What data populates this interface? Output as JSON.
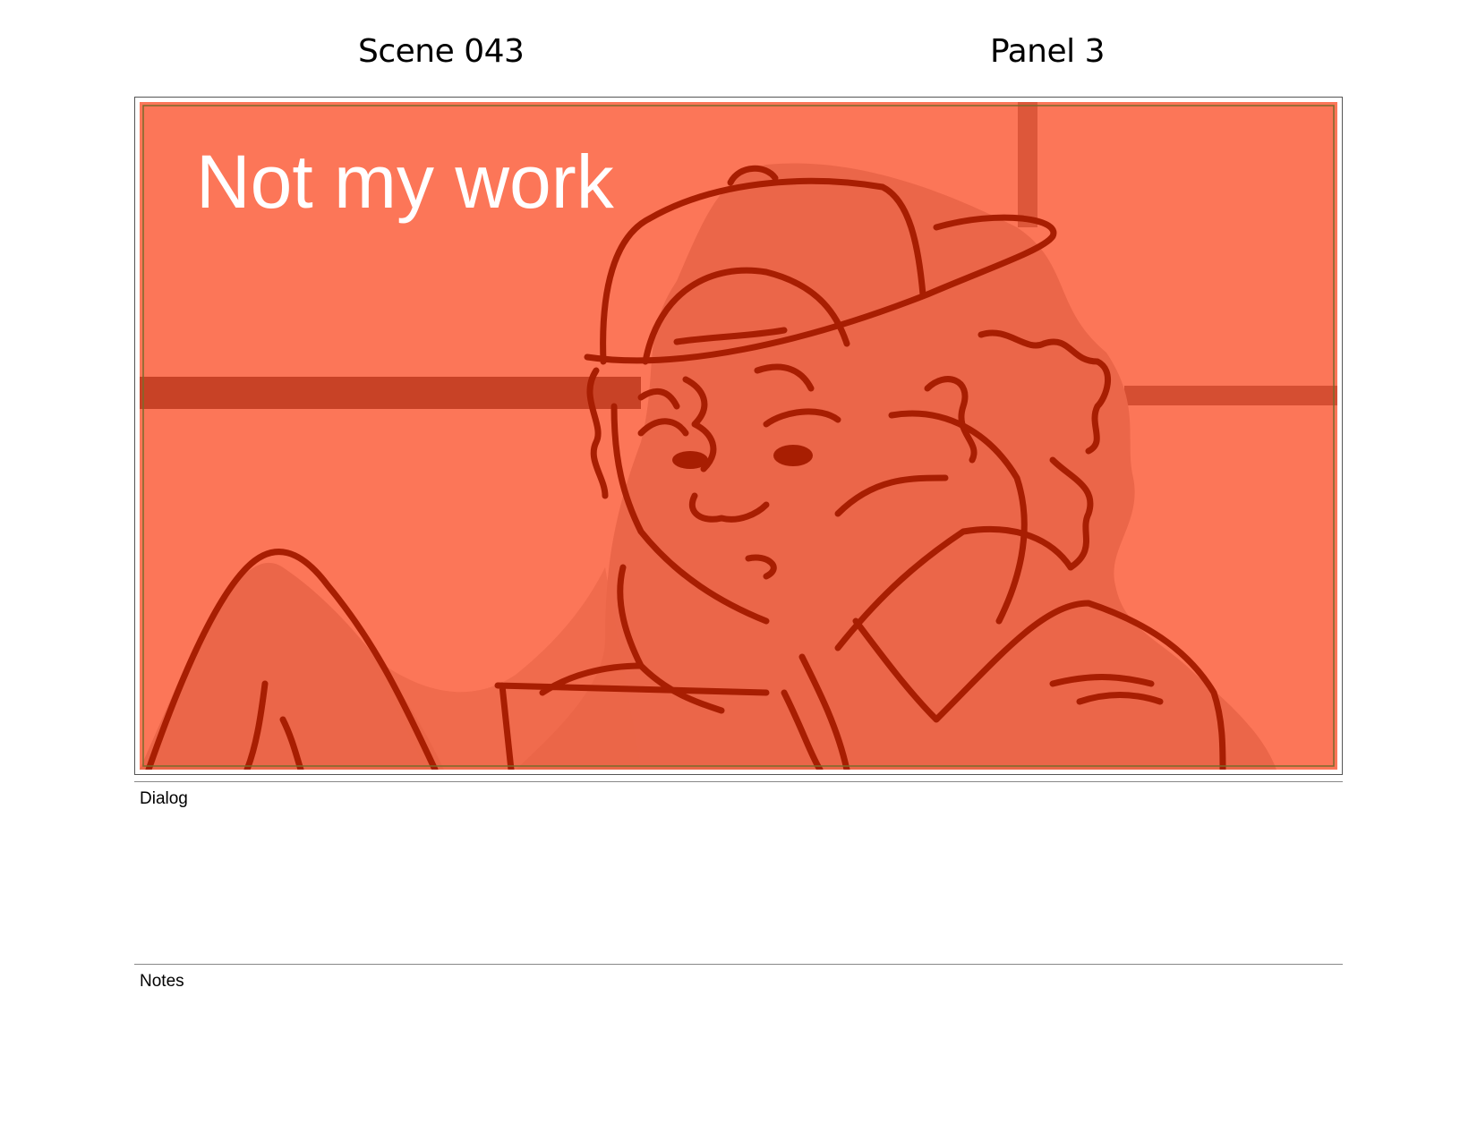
{
  "header": {
    "scene": "Scene 043",
    "panel": "Panel 3"
  },
  "panel_image": {
    "caption": "Not my work",
    "background_color": "#fc7658",
    "shadow_color": "#eb6649",
    "line_color": "#a81e02",
    "beam_color": "#c84226",
    "caption_color": "#ffffff",
    "border_color": "#7a6a2a"
  },
  "dialog": {
    "label": "Dialog",
    "text": ""
  },
  "notes": {
    "label": "Notes",
    "text": ""
  }
}
